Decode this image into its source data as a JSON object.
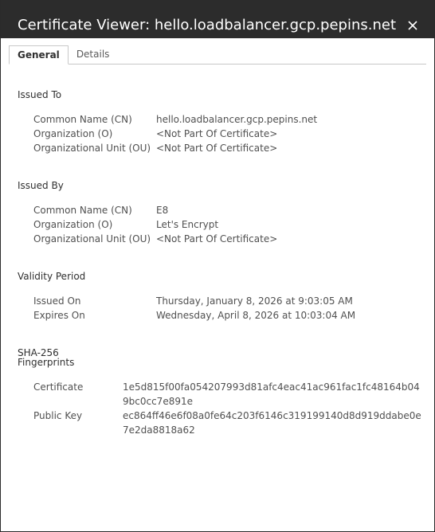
{
  "window": {
    "title": "Certificate Viewer: hello.loadbalancer.gcp.pepins.net",
    "close_glyph": "✕"
  },
  "tabs": [
    {
      "label": "General",
      "active": true
    },
    {
      "label": "Details",
      "active": false
    }
  ],
  "issued_to": {
    "heading": "Issued To",
    "rows": [
      {
        "label": "Common Name (CN)",
        "value": "hello.loadbalancer.gcp.pepins.net"
      },
      {
        "label": "Organization (O)",
        "value": "<Not Part Of Certificate>"
      },
      {
        "label": "Organizational Unit (OU)",
        "value": "<Not Part Of Certificate>"
      }
    ]
  },
  "issued_by": {
    "heading": "Issued By",
    "rows": [
      {
        "label": "Common Name (CN)",
        "value": "E8"
      },
      {
        "label": "Organization (O)",
        "value": "Let's Encrypt"
      },
      {
        "label": "Organizational Unit (OU)",
        "value": "<Not Part Of Certificate>"
      }
    ]
  },
  "validity": {
    "heading": "Validity Period",
    "rows": [
      {
        "label": "Issued On",
        "value": "Thursday, January 8, 2026 at 9:03:05 AM"
      },
      {
        "label": "Expires On",
        "value": "Wednesday, April 8, 2026 at 10:03:04 AM"
      }
    ]
  },
  "fingerprints": {
    "heading_line1": "SHA-256",
    "heading_line2": "Fingerprints",
    "rows": [
      {
        "label": "Certificate",
        "value": "1e5d815f00fa054207993d81afc4eac41ac961fac1fc48164b049bc0cc7e891e"
      },
      {
        "label": "Public Key",
        "value": "ec864ff46e6f08a0fe64c203f6146c319199140d8d919ddabe0e7e2da8818a62"
      }
    ]
  },
  "colors": {
    "titlebar": "#2c2c2c",
    "title_text": "#ffffff",
    "body_text": "#505050"
  }
}
